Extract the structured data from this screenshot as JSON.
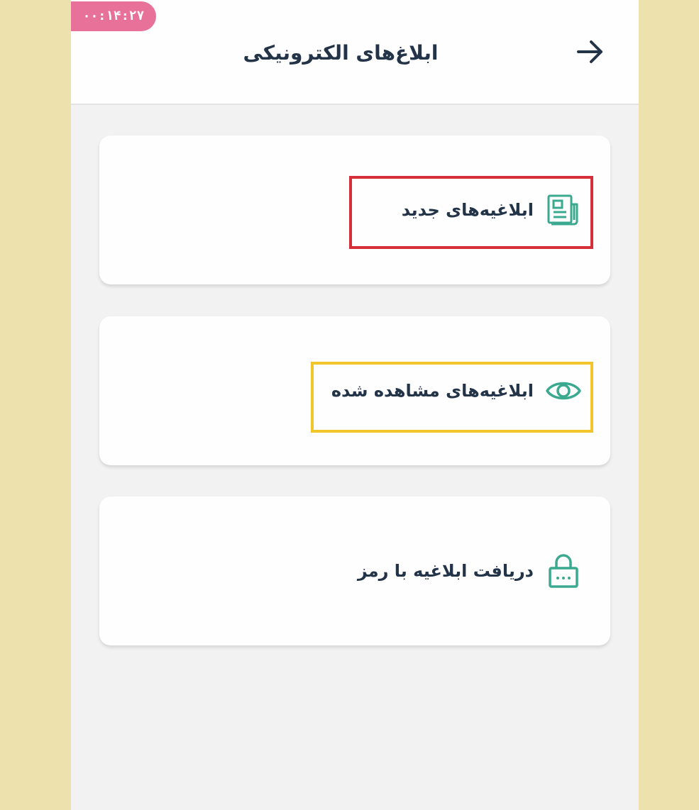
{
  "header": {
    "timer": "۰۰:۱۴:۲۷",
    "title": "ابلاغ‌های الکترونیکی",
    "back_icon": "arrow-right-icon"
  },
  "menu": {
    "items": [
      {
        "label": "ابلاغیه‌های جدید",
        "icon": "newspaper-icon"
      },
      {
        "label": "ابلاغیه‌های مشاهده شده",
        "icon": "eye-icon"
      },
      {
        "label": "دریافت ابلاغیه با رمز",
        "icon": "lock-icon"
      }
    ]
  },
  "annotations": {
    "highlight_1_color": "#d62f3a",
    "highlight_2_color": "#f1c62a"
  },
  "colors": {
    "accent": "#3aa98f",
    "text": "#233448",
    "timer_bg": "#e8719a",
    "page_bg": "#ede1ae"
  }
}
